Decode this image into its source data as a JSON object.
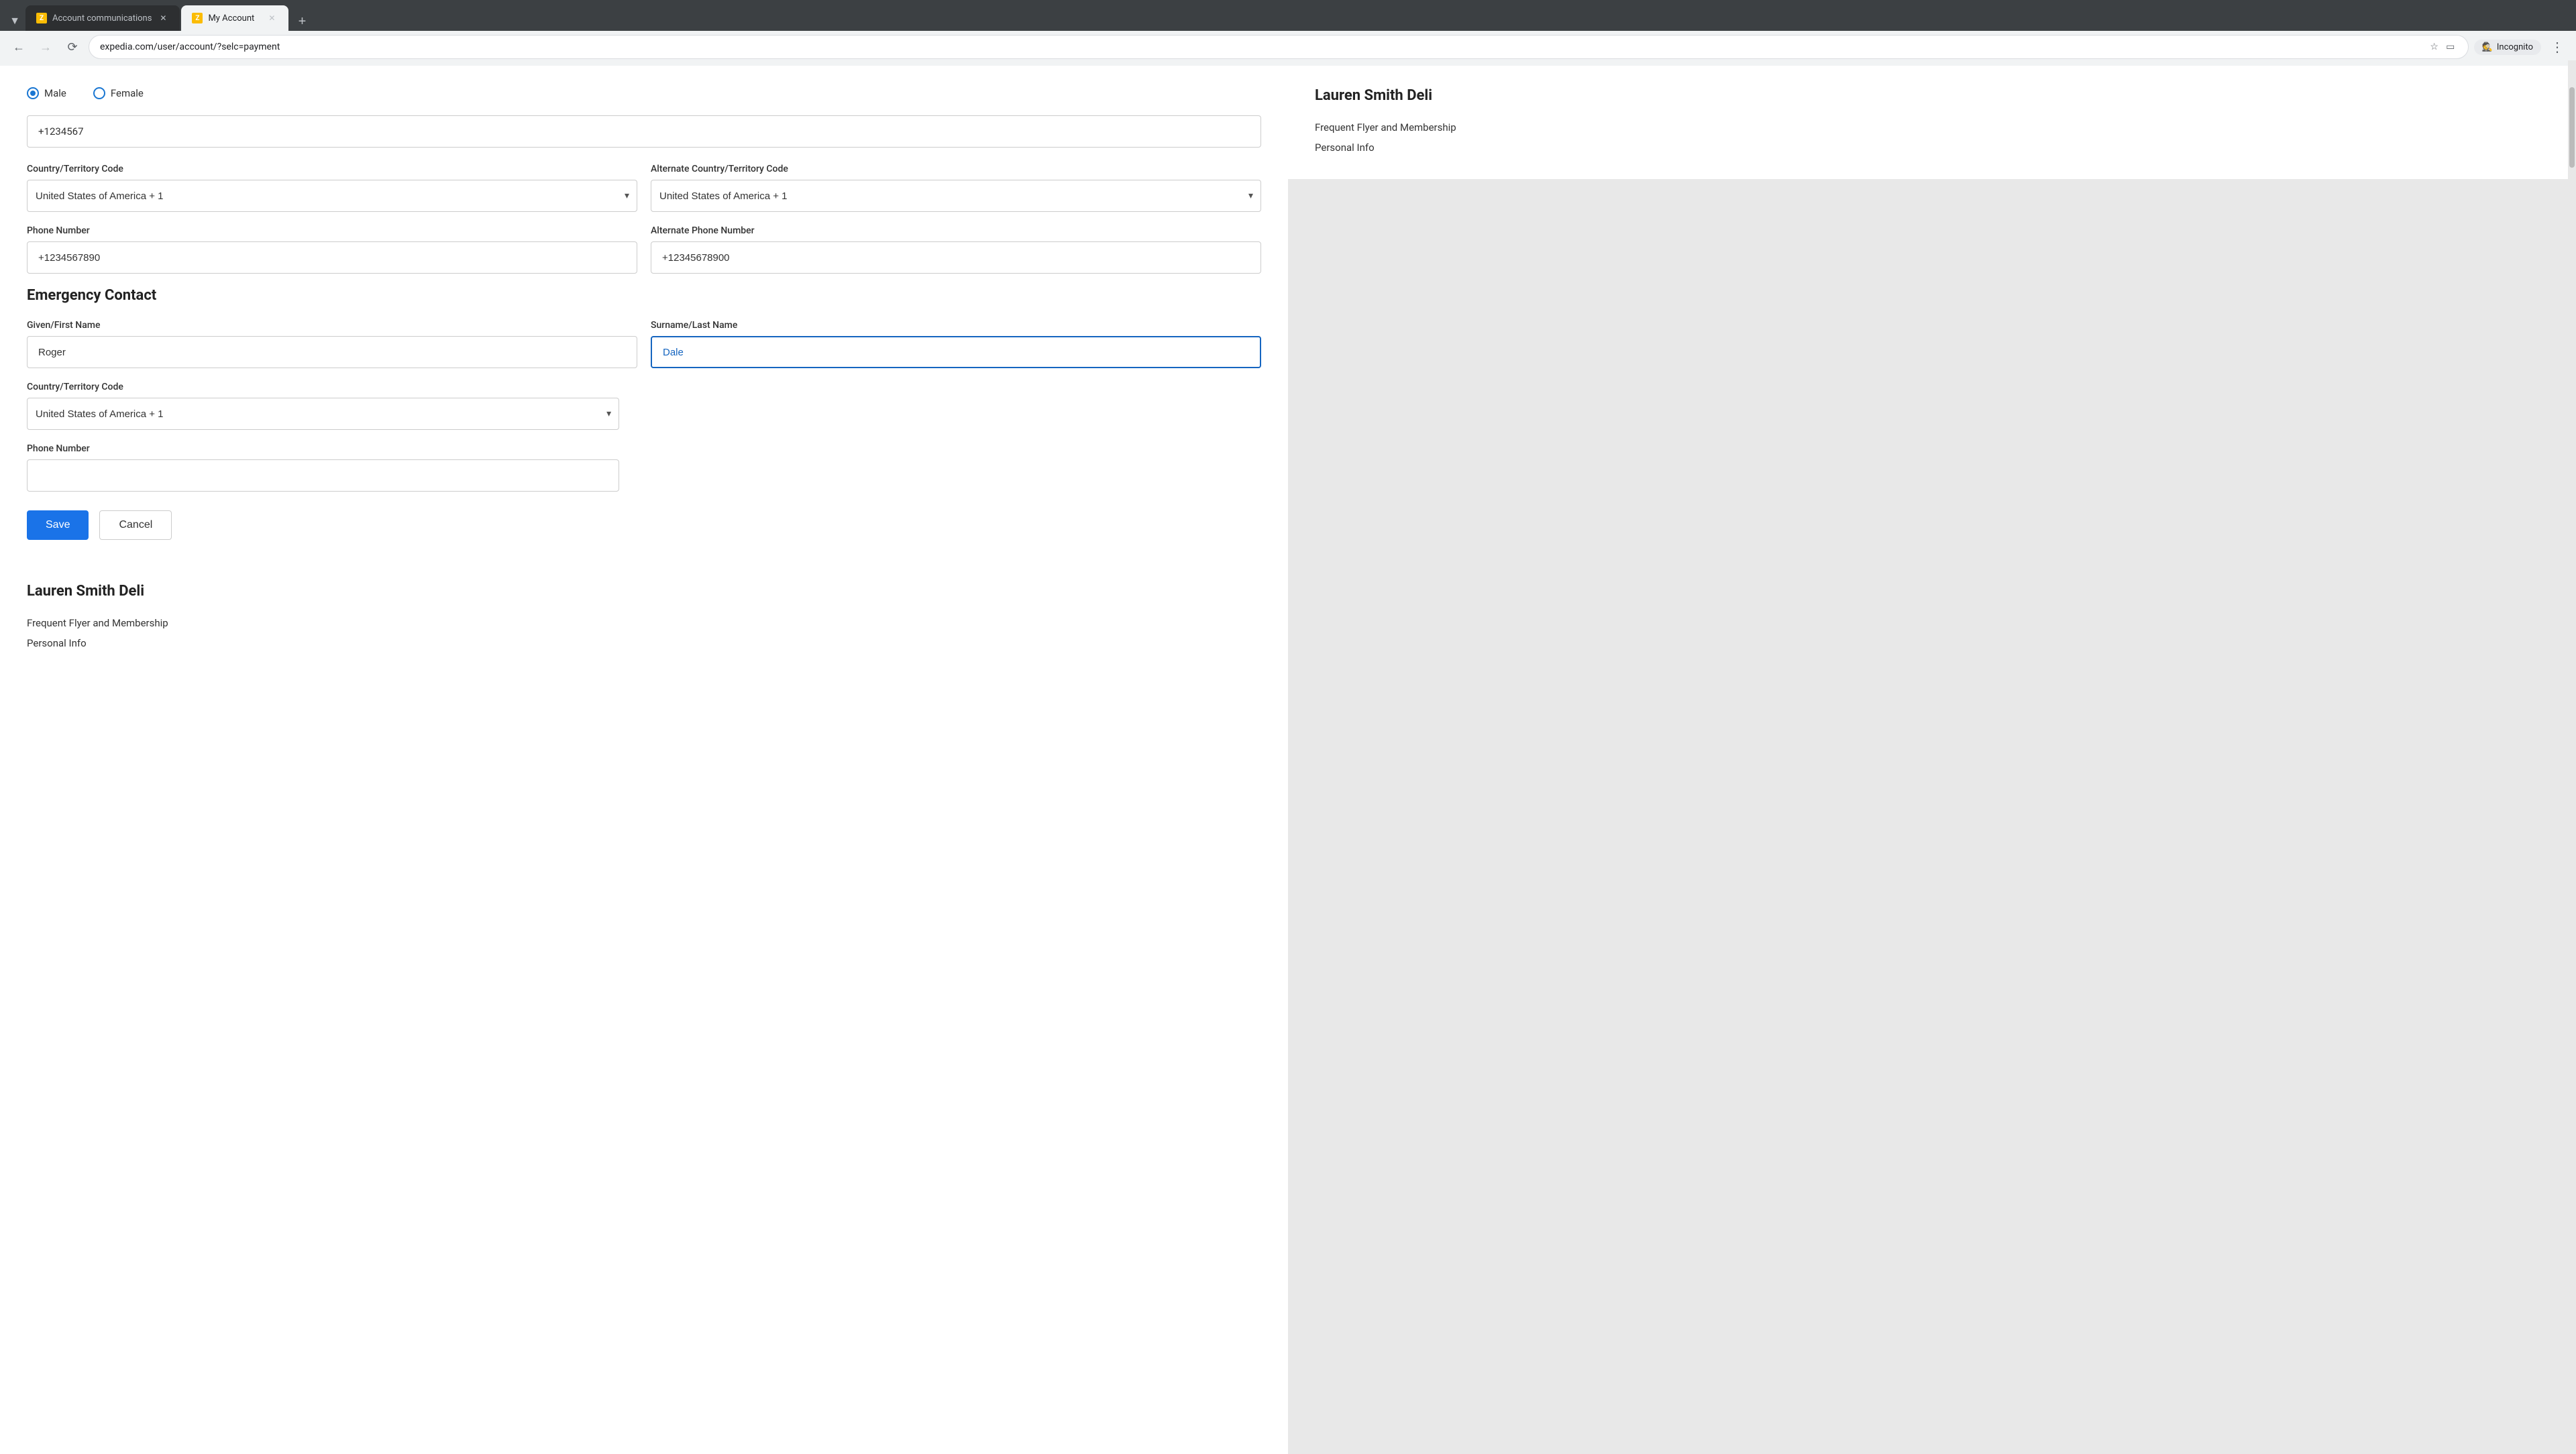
{
  "browser": {
    "tabs": [
      {
        "id": "tab1",
        "label": "Account communications",
        "favicon": "Z",
        "active": false,
        "closeable": true
      },
      {
        "id": "tab2",
        "label": "My Account",
        "favicon": "Z",
        "active": true,
        "closeable": true
      }
    ],
    "new_tab_label": "+",
    "url": "expedia.com/user/account/?selc=payment",
    "back_disabled": false,
    "forward_disabled": true,
    "incognito_label": "Incognito"
  },
  "form": {
    "gender_options": [
      "Male",
      "Female"
    ],
    "gender_selected": "Male",
    "partial_phone": "+1234567",
    "country_territory_code_label": "Country/Territory Code",
    "country_options": [
      "United States of America + 1"
    ],
    "country_selected": "United States of America + 1",
    "alt_country_territory_code_label": "Alternate Country/Territory Code",
    "alt_country_selected": "United States of America + 1",
    "phone_number_label": "Phone Number",
    "phone_value": "+1234567890",
    "alt_phone_number_label": "Alternate Phone Number",
    "alt_phone_value": "+12345678900",
    "emergency_contact_heading": "Emergency Contact",
    "given_name_label": "Given/First Name",
    "given_name_value": "Roger",
    "surname_label": "Surname/Last Name",
    "surname_value": "Dale",
    "ec_country_label": "Country/Territory Code",
    "ec_country_selected": "United States of America + 1",
    "ec_phone_label": "Phone Number",
    "ec_phone_value": "",
    "save_label": "Save",
    "cancel_label": "Cancel"
  },
  "bottom_cards": [
    {
      "title": "Lauren Smith Deli",
      "links": [
        "Frequent Flyer and Membership",
        "Personal Info"
      ]
    },
    {
      "title": "Lauren Smith Deli",
      "links": [
        "Frequent Flyer and Membership",
        "Personal Info"
      ]
    }
  ]
}
